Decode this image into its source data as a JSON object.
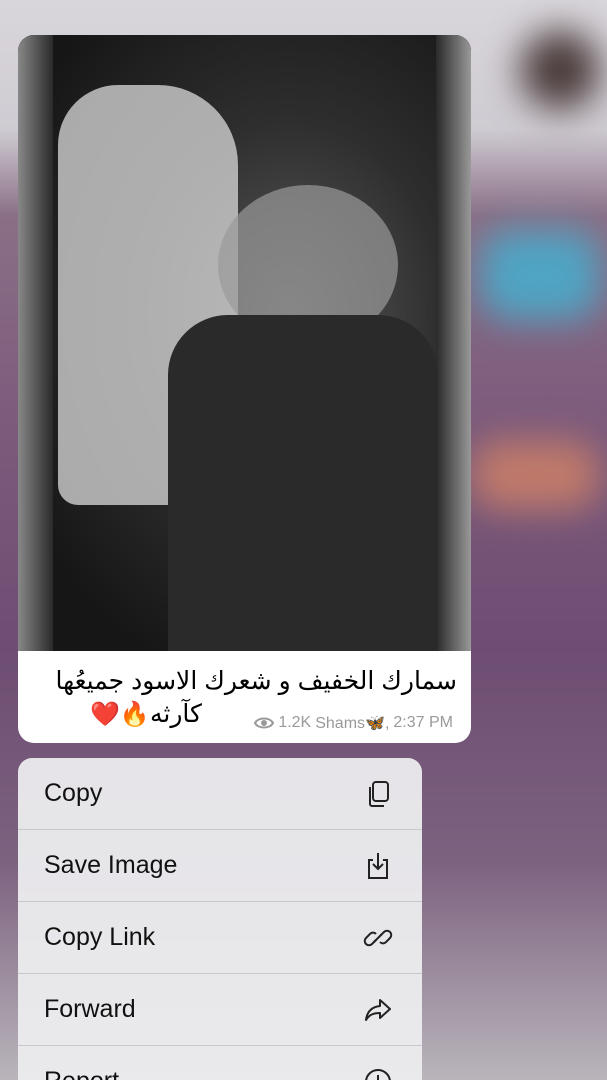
{
  "message": {
    "caption_line1": "سمارك الخفيف و شعرك الاسود جميعُها",
    "caption_line2": "كآرثه",
    "emojis": "❤️🔥",
    "views": "1.2K",
    "author": "Shams🦋,",
    "time": "2:37 PM"
  },
  "menu": {
    "items": [
      {
        "label": "Copy",
        "icon": "copy-icon"
      },
      {
        "label": "Save Image",
        "icon": "download-icon"
      },
      {
        "label": "Copy Link",
        "icon": "link-icon"
      },
      {
        "label": "Forward",
        "icon": "forward-icon"
      },
      {
        "label": "Report",
        "icon": "report-icon"
      }
    ]
  }
}
